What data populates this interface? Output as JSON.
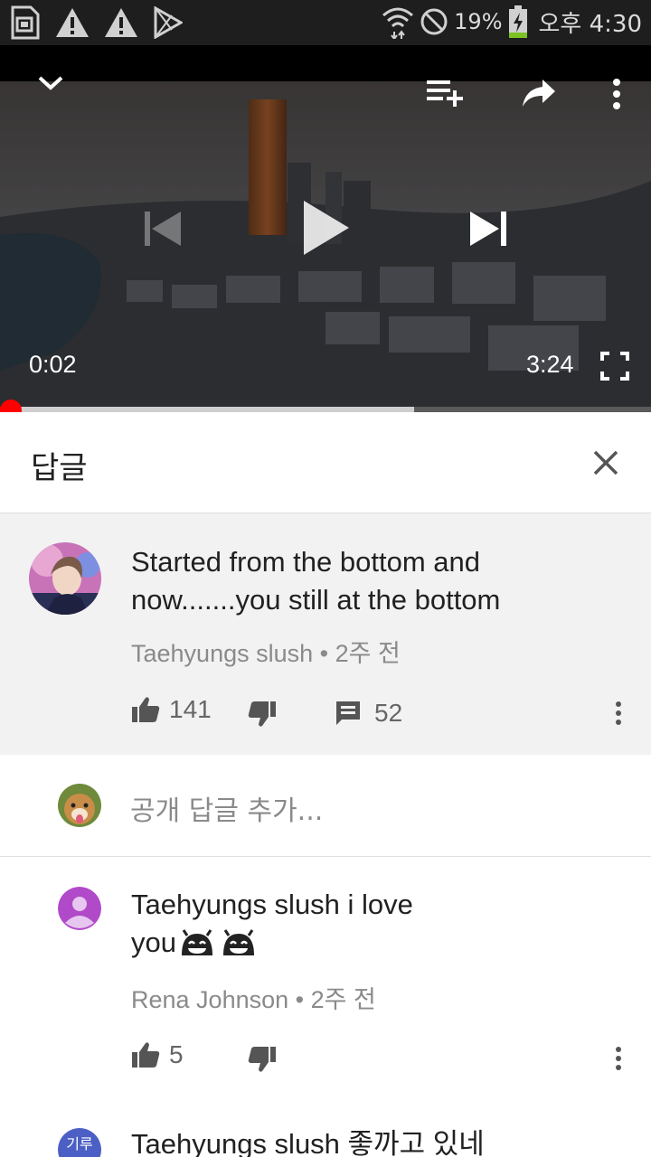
{
  "status_bar": {
    "battery_pct": "19%",
    "time": "오후 4:30",
    "icons": [
      "sd-card-icon",
      "warning-icon",
      "warning-icon",
      "play-store-icon",
      "wifi-icon",
      "no-disturb-icon",
      "battery-charging-icon"
    ]
  },
  "video": {
    "current_time": "0:02",
    "duration": "3:24",
    "progress_fraction": 0.01,
    "buffered_fraction": 0.636
  },
  "panel": {
    "title": "답글"
  },
  "main_comment": {
    "text": "Started from the bottom and now.......you still at the bottom",
    "author": "Taehyungs slush",
    "time": "2주 전",
    "likes": "141",
    "replies": "52"
  },
  "add_reply": {
    "placeholder": "공개 답글 추가..."
  },
  "replies": [
    {
      "text_line1": "Taehyungs slush i love",
      "text_line2": "you",
      "author": "Rena Johnson",
      "time": "2주 전",
      "likes": "5"
    },
    {
      "avatar_text": "기루",
      "text_line1": "Taehyungs slush 좋까고 있네"
    }
  ],
  "colors": {
    "accent_red": "#ff0000",
    "avatar_purple": "#b04ac9",
    "avatar_blue": "#4c5fc4"
  }
}
